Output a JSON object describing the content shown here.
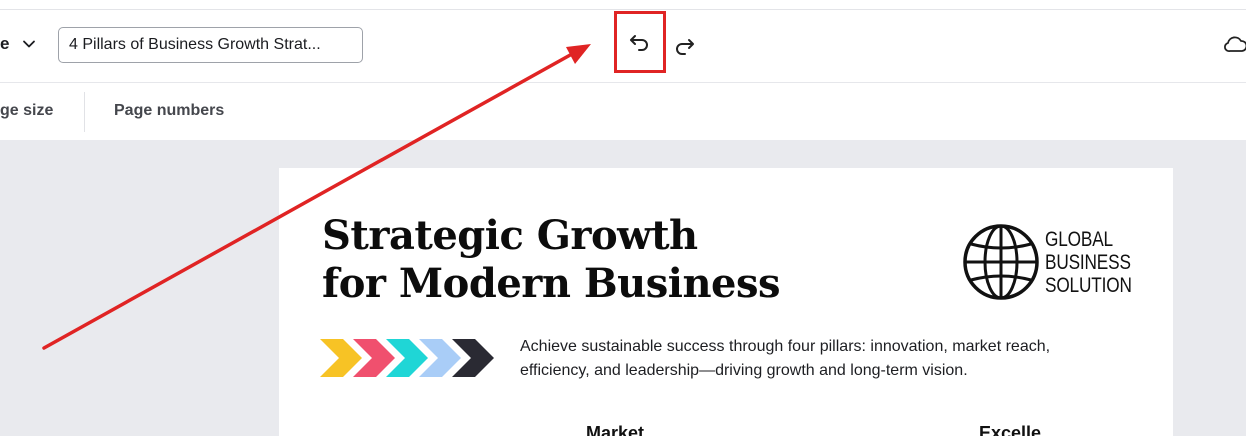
{
  "toolbar": {
    "menu_stub": "e",
    "doc_title": "4 Pillars of Business Growth Strat..."
  },
  "subbar": {
    "page_size": "ge size",
    "page_numbers": "Page numbers"
  },
  "document": {
    "headline_line1": "Strategic Growth",
    "headline_line2": "for Modern Business",
    "logo_line1": "GLOBAL",
    "logo_line2": "BUSINESS",
    "logo_line3": "SOLUTION",
    "description": "Achieve sustainable success through four pillars: innovation, market reach, efficiency, and leadership—driving growth and long-term vision.",
    "section_label_1": "Market",
    "section_label_2": "Excelle"
  },
  "colors": {
    "annotation_red": "#e02424",
    "chevron_1": "#f7c325",
    "chevron_2": "#f0506e",
    "chevron_3": "#1fd6d6",
    "chevron_4": "#a9cdf7",
    "chevron_5": "#2a2a33"
  }
}
